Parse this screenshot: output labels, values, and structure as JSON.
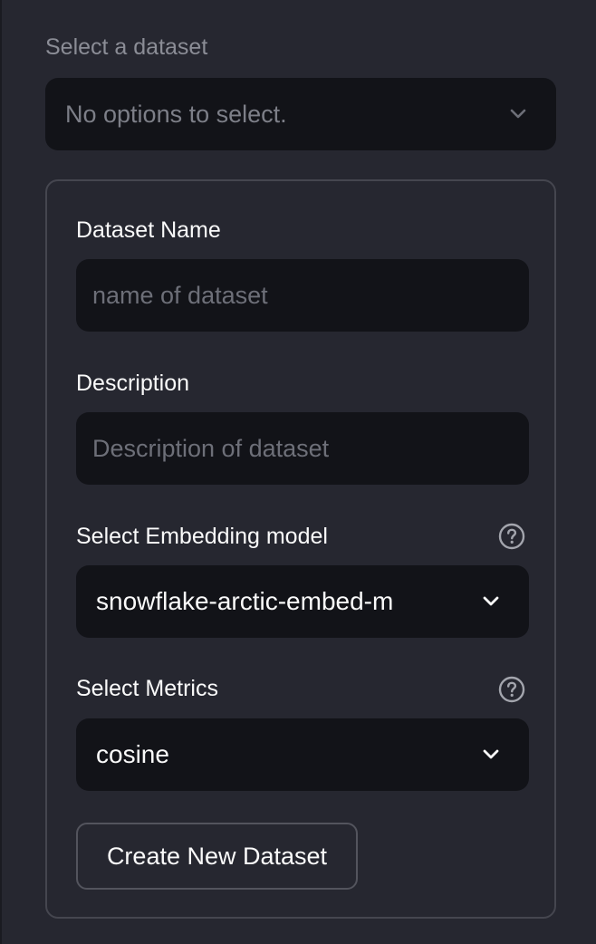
{
  "dataset_select": {
    "label": "Select a dataset",
    "value": "No options to select."
  },
  "form": {
    "dataset_name": {
      "label": "Dataset Name",
      "placeholder": "name of dataset"
    },
    "description": {
      "label": "Description",
      "placeholder": "Description of dataset"
    },
    "embedding_model": {
      "label": "Select Embedding model",
      "value": "snowflake-arctic-embed-m"
    },
    "metrics": {
      "label": "Select Metrics",
      "value": "cosine"
    },
    "create_button_label": "Create New Dataset"
  },
  "icons": {
    "dropdown": "chevron-down-icon",
    "help": "question-circle-icon"
  },
  "colors": {
    "background": "#262730",
    "input_background": "#121318",
    "text": "#fafafa",
    "muted_text": "#8b8d96",
    "border": "#45464f"
  }
}
